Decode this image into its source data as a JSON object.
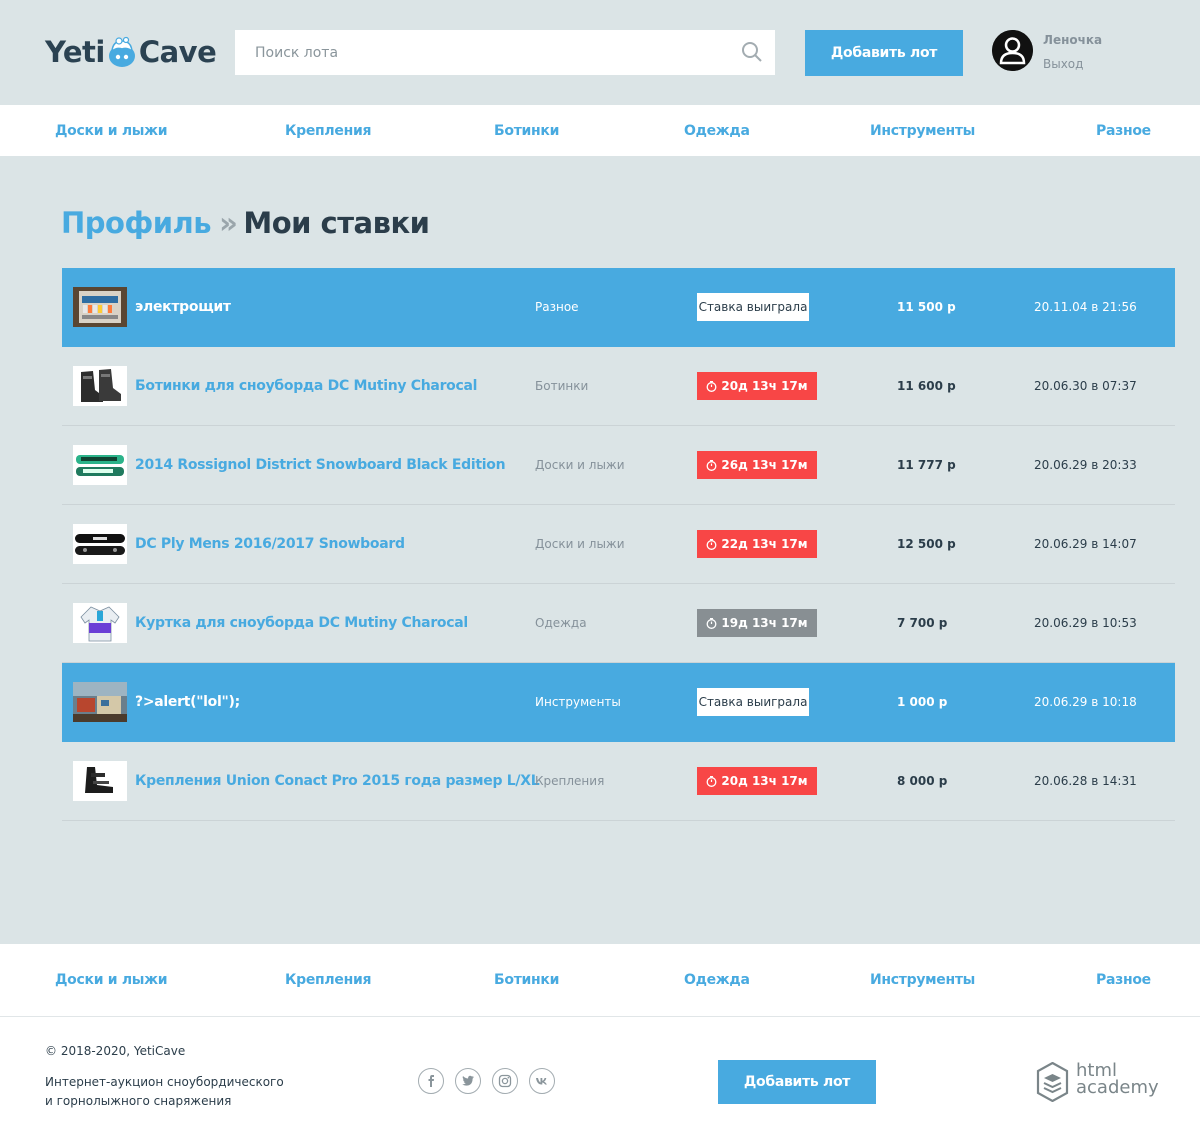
{
  "header": {
    "logo_left": "Yeti",
    "logo_right": "Cave",
    "search_placeholder": "Поиск лота",
    "add_lot_label": "Добавить лот",
    "user_name": "Леночка",
    "logout_label": "Выход"
  },
  "nav": [
    {
      "label": "Доски и лыжи"
    },
    {
      "label": "Крепления"
    },
    {
      "label": "Ботинки"
    },
    {
      "label": "Одежда"
    },
    {
      "label": "Инструменты"
    },
    {
      "label": "Разное"
    }
  ],
  "breadcrumbs": {
    "parent": "Профиль",
    "separator": "»",
    "current": "Мои ставки"
  },
  "bets": [
    {
      "title": "электрощит",
      "category": "Разное",
      "status": "Ставка выиграла",
      "status_type": "won",
      "price": "11 500 р",
      "time": "20.11.04 в 21:56",
      "image": "electrical-panel"
    },
    {
      "title": "Ботинки для сноуборда DC Mutiny Charocal",
      "category": "Ботинки",
      "status": "20д 13ч 17м",
      "status_type": "active",
      "price": "11 600 р",
      "time": "20.06.30 в 07:37",
      "image": "snowboard-boots"
    },
    {
      "title": "2014 Rossignol District Snowboard Black Edition",
      "category": "Доски и лыжи",
      "status": "26д 13ч 17м",
      "status_type": "active",
      "price": "11 777 р",
      "time": "20.06.29 в 20:33",
      "image": "rossignol-board"
    },
    {
      "title": "DC Ply Mens 2016/2017 Snowboard",
      "category": "Доски и лыжи",
      "status": "22д 13ч 17м",
      "status_type": "active",
      "price": "12 500 р",
      "time": "20.06.29 в 14:07",
      "image": "black-snowboard"
    },
    {
      "title": "Куртка для сноуборда DC Mutiny Charocal",
      "category": "Одежда",
      "status": "19д 13ч 17м",
      "status_type": "ended",
      "price": "7 700 р",
      "time": "20.06.29 в 10:53",
      "image": "snowboard-jacket"
    },
    {
      "title": "?>alert(\"lol\");",
      "category": "Инструменты",
      "status": "Ставка выиграла",
      "status_type": "won",
      "price": "1 000 р",
      "time": "20.06.29 в 10:18",
      "image": "tools-photo"
    },
    {
      "title": "Крепления Union Conact Pro 2015 года размер L/XL",
      "category": "Крепления",
      "status": "20д 13ч 17м",
      "status_type": "active",
      "price": "8 000 р",
      "time": "20.06.28 в 14:31",
      "image": "snowboard-bindings"
    }
  ],
  "footer": {
    "copyright": "© 2018-2020, YetiCave",
    "about_line1": "Интернет-аукцион сноубордического",
    "about_line2": "и горнолыжного снаряжения",
    "add_lot_label": "Добавить лот",
    "academy_line1": "html",
    "academy_line2": "academy",
    "social": [
      "facebook-icon",
      "twitter-icon",
      "instagram-icon",
      "vk-icon"
    ]
  },
  "colors": {
    "accent": "#48aae0",
    "background": "#dbe4e6",
    "timer_active": "#f84646",
    "timer_ended": "#888f93",
    "text_dark": "#2b3d4a"
  }
}
